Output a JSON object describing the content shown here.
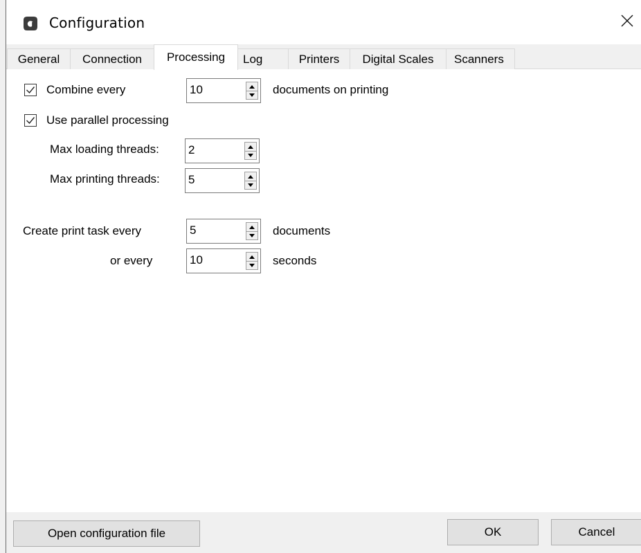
{
  "window": {
    "title": "Configuration",
    "app_icon": "app-logo-icon",
    "close_icon": "close-icon"
  },
  "tabs": [
    {
      "label": "General",
      "active": false
    },
    {
      "label": "Connection",
      "active": false
    },
    {
      "label": "Processing",
      "active": true
    },
    {
      "label": "Log",
      "active": false
    },
    {
      "label": "Printers",
      "active": false
    },
    {
      "label": "Digital Scales",
      "active": false
    },
    {
      "label": "Scanners",
      "active": false
    }
  ],
  "processing": {
    "combine": {
      "checked": true,
      "label": "Combine every",
      "value": "10",
      "suffix": "documents on printing"
    },
    "parallel": {
      "checked": true,
      "label": "Use parallel processing"
    },
    "max_loading": {
      "label": "Max loading threads:",
      "value": "2"
    },
    "max_printing": {
      "label": "Max printing threads:",
      "value": "5"
    },
    "print_task": {
      "label": "Create print task every",
      "value": "5",
      "suffix": "documents"
    },
    "or_every": {
      "label": "or every",
      "value": "10",
      "suffix": "seconds"
    }
  },
  "footer": {
    "open_config_label": "Open configuration file",
    "ok_label": "OK",
    "cancel_label": "Cancel"
  },
  "colors": {
    "panel_bg": "#ffffff",
    "dialog_bg": "#f0f0f0",
    "button_bg": "#e1e1e1",
    "app_icon": "#3c3c3c"
  }
}
